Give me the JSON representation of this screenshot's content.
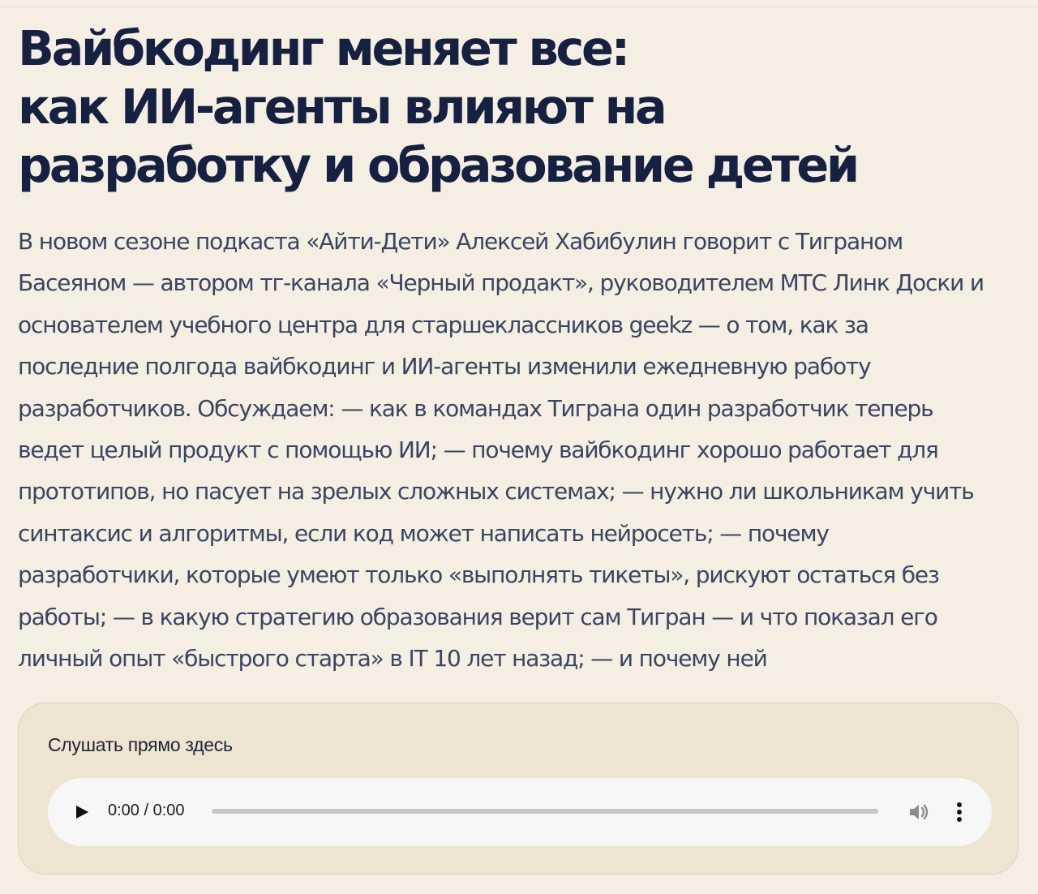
{
  "article": {
    "title_lines": [
      "Вайбкодинг меняет все:",
      "как ИИ-агенты влияют на",
      "разработку и образование детей"
    ],
    "lead": "В новом сезоне подкаста «Айти-Дети» Алексей Хабибулин говорит с Тиграном Басеяном — автором тг-канала «Черный продакт», руководителем МТС Линк Доски и основателем учебного центра для старшеклассников geekz — о том, как за последние полгода вайбкодинг и ИИ-агенты изменили ежедневную работу разработчиков. Обсуждаем: — как в командах Тиграна один разработчик теперь ведет целый продукт с помощью ИИ; — почему вайбкодинг хорошо работает для прототипов, но пасует на зрелых сложных системах; — нужно ли школьникам учить синтаксис и алгоритмы, если код может написать нейросеть; — почему разработчики, которые умеют только «выполнять тикеты», рискуют остаться без работы; — в какую стратегию образования верит сам Тигран — и что показал его личный опыт «быстрого старта» в IT 10 лет назад; — и почему ней"
  },
  "player": {
    "label": "Слушать прямо здесь",
    "time_display": "0:00 / 0:00",
    "progress": 0,
    "play_icon": "play-icon",
    "volume_icon": "volume-icon",
    "more_icon": "more-vertical-icon"
  },
  "colors": {
    "background": "#f5efe3",
    "title": "#162040",
    "lead_text": "#3a4562",
    "card_background": "#ede4d2",
    "audio_bar_background": "#f7f7f7"
  }
}
